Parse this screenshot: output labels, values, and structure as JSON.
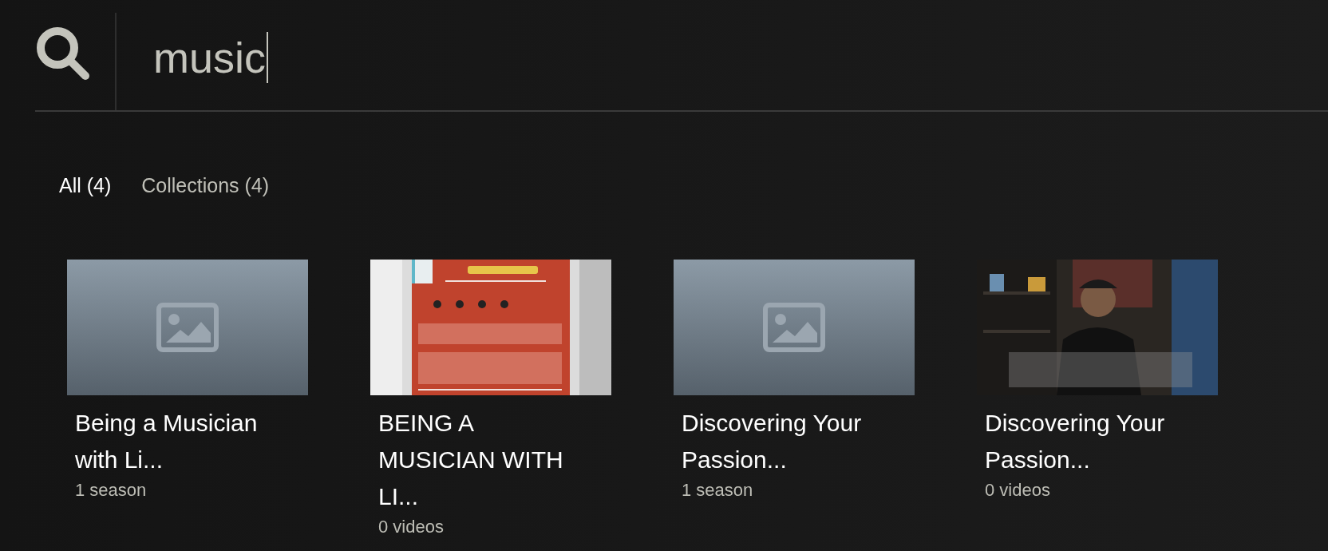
{
  "search": {
    "value": "music"
  },
  "tabs": [
    {
      "label": "All (4)",
      "selected": true
    },
    {
      "label": "Collections (4)",
      "selected": false
    }
  ],
  "results": [
    {
      "title": "Being a Musician with Li...",
      "meta": "1 season",
      "kind": "placeholder"
    },
    {
      "title": "BEING A MUSICIAN WITH LI...",
      "meta": "0 videos",
      "kind": "picture"
    },
    {
      "title": "Discovering Your Passion...",
      "meta": "1 season",
      "kind": "placeholder"
    },
    {
      "title": "Discovering Your Passion...",
      "meta": "0 videos",
      "kind": "picture"
    }
  ]
}
